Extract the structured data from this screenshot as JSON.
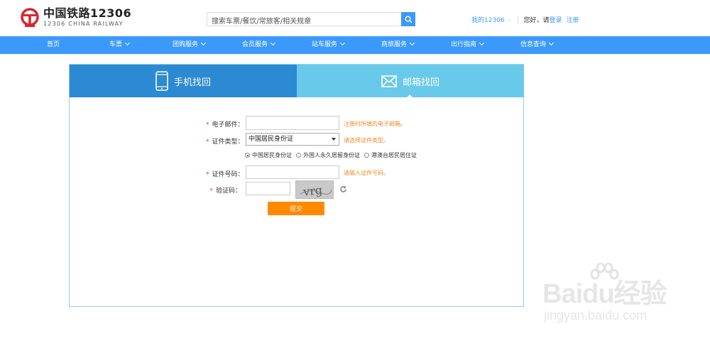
{
  "header": {
    "logo_cn": "中国铁路12306",
    "logo_en": "12306 CHINA RAILWAY",
    "search_placeholder": "搜索车票/餐饮/常旅客/相关规章",
    "my_account": "我的12306",
    "greeting": "您好，请",
    "login": "登录",
    "register": "注册",
    "brand_color": "#3b99fc"
  },
  "nav": {
    "items": [
      {
        "label": "首页",
        "dropdown": false
      },
      {
        "label": "车票",
        "dropdown": true
      },
      {
        "label": "团购服务",
        "dropdown": true
      },
      {
        "label": "会员服务",
        "dropdown": true
      },
      {
        "label": "站车服务",
        "dropdown": true
      },
      {
        "label": "商旅服务",
        "dropdown": true
      },
      {
        "label": "出行指南",
        "dropdown": true
      },
      {
        "label": "信息查询",
        "dropdown": true
      }
    ]
  },
  "tabs": {
    "phone": "手机找回",
    "email": "邮箱找回",
    "active": "email"
  },
  "form": {
    "email_label": "电子邮件：",
    "email_value": "",
    "email_hint": "注册时所填的电子邮箱。",
    "idtype_label": "证件类型：",
    "idtype_selected": "中国居民身份证",
    "idtype_hint": "请选择证件类型。",
    "radios": [
      {
        "label": "中国居民身份证",
        "checked": true
      },
      {
        "label": "外国人永久居留身份证",
        "checked": false
      },
      {
        "label": "港澳台居民居住证",
        "checked": false
      }
    ],
    "idnum_label": "证件号码：",
    "idnum_value": "",
    "idnum_hint": "请输入证件号码。",
    "captcha_label": "验证码：",
    "captcha_value": "",
    "captcha_text": "vrg",
    "submit": "提交"
  },
  "watermark": {
    "top": "Baidu经验",
    "bottom": "jingyan.baidu.com"
  }
}
